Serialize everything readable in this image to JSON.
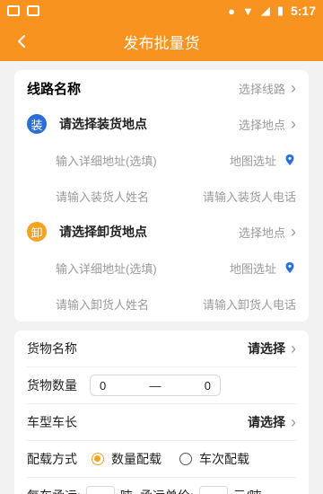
{
  "status": {
    "time": "5:17",
    "icons": [
      "image-icon",
      "a-icon",
      "location-icon",
      "wifi-icon",
      "signal-icon",
      "battery-icon"
    ]
  },
  "header": {
    "title": "发布批量货",
    "back_icon": "chevron-left-icon"
  },
  "route": {
    "label": "线路名称",
    "action": "选择线路"
  },
  "load": {
    "badge": "装",
    "title": "请选择装货地点",
    "action": "选择地点",
    "address_placeholder": "输入详细地址(选填)",
    "map_label": "地图选址",
    "name_placeholder": "请输入装货人姓名",
    "phone_placeholder": "请输入装货人电话"
  },
  "unload": {
    "badge": "卸",
    "title": "请选择卸货地点",
    "action": "选择地点",
    "address_placeholder": "输入详细地址(选填)",
    "map_label": "地图选址",
    "name_placeholder": "请输入卸货人姓名",
    "phone_placeholder": "请输入卸货人电话"
  },
  "cargo": {
    "name_label": "货物名称",
    "name_value": "请选择",
    "qty_label": "货物数量",
    "qty_min": "0",
    "qty_sep": "—",
    "qty_max": "0",
    "vehicle_label": "车型车长",
    "vehicle_value": "请选择",
    "mode_label": "配载方式",
    "mode_option1": "数量配载",
    "mode_option2": "车次配载",
    "per_truck_label": "每车承运:",
    "per_truck_unit": "吨",
    "price_label": "承运单价:",
    "price_unit": "元/吨"
  },
  "colors": {
    "accent": "#f7931e",
    "blue": "#2b6fd6",
    "orange_badge": "#f3a31d"
  }
}
